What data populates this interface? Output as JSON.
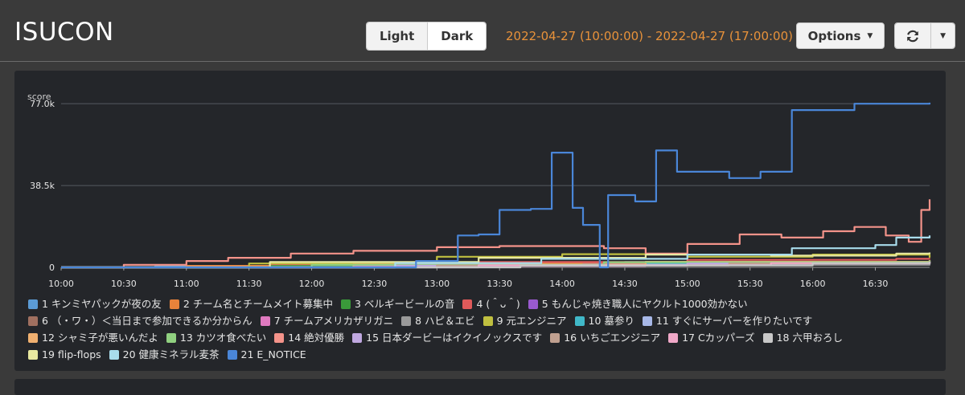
{
  "app": {
    "title": "ISUCON"
  },
  "theme": {
    "light_label": "Light",
    "dark_label": "Dark",
    "selected": "Dark"
  },
  "time_range": {
    "label": "2022-04-27 (10:00:00) - 2022-04-27 (17:00:00)",
    "icon": "caret-down-icon"
  },
  "options": {
    "label": "Options",
    "icon": "caret-down-icon"
  },
  "refresh": {
    "icon": "refresh-icon",
    "dropdown_icon": "caret-down-icon"
  },
  "colors": {
    "background": "#3a3a3a",
    "panel": "#24262a",
    "date_accent": "#e8923a",
    "grid": "#555a60"
  },
  "chart_data": {
    "type": "line",
    "ylabel": "score",
    "ylim": [
      0,
      85000
    ],
    "yticks": [
      {
        "value": 0,
        "label": "0"
      },
      {
        "value": 38500,
        "label": "38.5k"
      },
      {
        "value": 77000,
        "label": "77.0k"
      }
    ],
    "xticks": [
      "10:00",
      "10:30",
      "11:00",
      "11:30",
      "12:00",
      "12:30",
      "13:00",
      "13:30",
      "14:00",
      "14:30",
      "15:00",
      "15:30",
      "16:00",
      "16:30"
    ],
    "x_start_minutes": 600,
    "x_end_minutes": 1016,
    "grid": true,
    "legend": "bottom",
    "series": [
      {
        "name": "1 キンミヤパックが夜の友",
        "color": "#5b9bd5",
        "points": [
          [
            600,
            0
          ],
          [
            645,
            500
          ],
          [
            700,
            1000
          ],
          [
            780,
            1500
          ],
          [
            830,
            1800
          ],
          [
            850,
            2200
          ],
          [
            870,
            2500
          ]
        ]
      },
      {
        "name": "2 チーム名とチームメイト募集中",
        "color": "#e8823a",
        "points": [
          [
            600,
            0
          ],
          [
            660,
            700
          ],
          [
            720,
            1500
          ],
          [
            800,
            2000
          ],
          [
            880,
            2500
          ],
          [
            1016,
            2800
          ]
        ]
      },
      {
        "name": "3 ベルギービールの音",
        "color": "#3a9a3a",
        "points": [
          [
            600,
            0
          ],
          [
            700,
            800
          ],
          [
            800,
            1200
          ],
          [
            900,
            1600
          ],
          [
            1016,
            2000
          ]
        ]
      },
      {
        "name": "4 (＾ᴗ＾)",
        "color": "#e05a5a",
        "points": [
          [
            600,
            0
          ],
          [
            700,
            1500
          ],
          [
            800,
            2500
          ],
          [
            900,
            3500
          ],
          [
            1000,
            4000
          ],
          [
            1016,
            4200
          ]
        ]
      },
      {
        "name": "5 もんじゃ焼き職人にヤクルト1000効かない",
        "color": "#9a5ad0",
        "points": [
          [
            600,
            0
          ],
          [
            750,
            800
          ],
          [
            850,
            1500
          ],
          [
            950,
            2200
          ],
          [
            1016,
            2600
          ]
        ]
      },
      {
        "name": "6 （・ワ・）＜当日まで参加できるか分からん",
        "color": "#a07060",
        "points": [
          [
            600,
            0
          ],
          [
            760,
            900
          ],
          [
            900,
            1800
          ],
          [
            1016,
            2400
          ]
        ]
      },
      {
        "name": "7 チームアメリカザリガニ",
        "color": "#e07ac0",
        "points": [
          [
            600,
            0
          ],
          [
            740,
            700
          ],
          [
            880,
            1600
          ],
          [
            1016,
            2200
          ]
        ]
      },
      {
        "name": "8 ハピ＆エビ",
        "color": "#9a9a9a",
        "points": [
          [
            600,
            0
          ],
          [
            820,
            1200
          ],
          [
            1016,
            2100
          ]
        ]
      },
      {
        "name": "9 元エンジニア",
        "color": "#c0c040",
        "points": [
          [
            600,
            0
          ],
          [
            690,
            1800
          ],
          [
            780,
            5000
          ],
          [
            840,
            6200
          ],
          [
            900,
            5000
          ],
          [
            960,
            6000
          ],
          [
            1016,
            4500
          ]
        ]
      },
      {
        "name": "10 墓参り",
        "color": "#40b8c8",
        "points": [
          [
            600,
            0
          ],
          [
            780,
            1000
          ],
          [
            880,
            2000
          ],
          [
            1016,
            3000
          ]
        ]
      },
      {
        "name": "11 すぐにサーバーを作りたいです",
        "color": "#a8b8e8",
        "points": [
          [
            600,
            0
          ],
          [
            760,
            1200
          ],
          [
            900,
            2200
          ],
          [
            1016,
            3200
          ]
        ]
      },
      {
        "name": "12 シャミ子が悪いんだよ",
        "color": "#f0b070",
        "points": [
          [
            600,
            0
          ],
          [
            740,
            1400
          ],
          [
            880,
            2600
          ],
          [
            1016,
            3400
          ]
        ]
      },
      {
        "name": "13 カツオ食べたい",
        "color": "#90d080",
        "points": [
          [
            600,
            0
          ],
          [
            720,
            1200
          ],
          [
            860,
            2400
          ],
          [
            1016,
            3200
          ]
        ]
      },
      {
        "name": "14 絶対優勝",
        "color": "#f4938a",
        "points": [
          [
            600,
            0
          ],
          [
            630,
            1200
          ],
          [
            660,
            3000
          ],
          [
            680,
            4500
          ],
          [
            710,
            6500
          ],
          [
            740,
            7800
          ],
          [
            780,
            9500
          ],
          [
            810,
            10000
          ],
          [
            860,
            9000
          ],
          [
            880,
            6500
          ],
          [
            900,
            11000
          ],
          [
            925,
            15500
          ],
          [
            945,
            14000
          ],
          [
            965,
            17000
          ],
          [
            980,
            19000
          ],
          [
            995,
            15000
          ],
          [
            1006,
            12000
          ],
          [
            1012,
            27000
          ],
          [
            1016,
            32000
          ]
        ]
      },
      {
        "name": "15 日本ダービーはイクイノックスです",
        "color": "#c0a8e0",
        "points": [
          [
            600,
            0
          ],
          [
            760,
            800
          ],
          [
            900,
            1800
          ],
          [
            1016,
            2600
          ]
        ]
      },
      {
        "name": "16 いちごエンジニア",
        "color": "#c0a090",
        "points": [
          [
            600,
            0
          ],
          [
            780,
            900
          ],
          [
            920,
            1900
          ],
          [
            1016,
            2500
          ]
        ]
      },
      {
        "name": "17 Cカッパーズ",
        "color": "#f0a8c8",
        "points": [
          [
            600,
            0
          ],
          [
            800,
            1000
          ],
          [
            940,
            2000
          ],
          [
            1016,
            2700
          ]
        ]
      },
      {
        "name": "18 六甲おろし",
        "color": "#c8c8c8",
        "points": [
          [
            600,
            0
          ],
          [
            820,
            900
          ],
          [
            960,
            2000
          ],
          [
            1016,
            2500
          ]
        ]
      },
      {
        "name": "19 flip-flops",
        "color": "#e8e8a0",
        "points": [
          [
            600,
            0
          ],
          [
            700,
            2500
          ],
          [
            800,
            4500
          ],
          [
            880,
            6000
          ],
          [
            940,
            5500
          ],
          [
            1000,
            6500
          ],
          [
            1016,
            7000
          ]
        ]
      },
      {
        "name": "20 健康ミネラル麦茶",
        "color": "#a8dcec",
        "points": [
          [
            600,
            0
          ],
          [
            760,
            2000
          ],
          [
            830,
            4000
          ],
          [
            900,
            6000
          ],
          [
            950,
            9000
          ],
          [
            990,
            10500
          ],
          [
            1000,
            14000
          ],
          [
            1016,
            15000
          ]
        ]
      },
      {
        "name": "21 E_NOTICE",
        "color": "#4a86d8",
        "points": [
          [
            600,
            0
          ],
          [
            770,
            3000
          ],
          [
            790,
            15000
          ],
          [
            800,
            15500
          ],
          [
            810,
            27000
          ],
          [
            825,
            27500
          ],
          [
            835,
            54000
          ],
          [
            845,
            28000
          ],
          [
            850,
            20000
          ],
          [
            858,
            0
          ],
          [
            862,
            34000
          ],
          [
            875,
            31000
          ],
          [
            885,
            55000
          ],
          [
            895,
            45000
          ],
          [
            920,
            42000
          ],
          [
            935,
            45000
          ],
          [
            950,
            74000
          ],
          [
            980,
            77000
          ],
          [
            1016,
            77500
          ]
        ]
      }
    ]
  }
}
